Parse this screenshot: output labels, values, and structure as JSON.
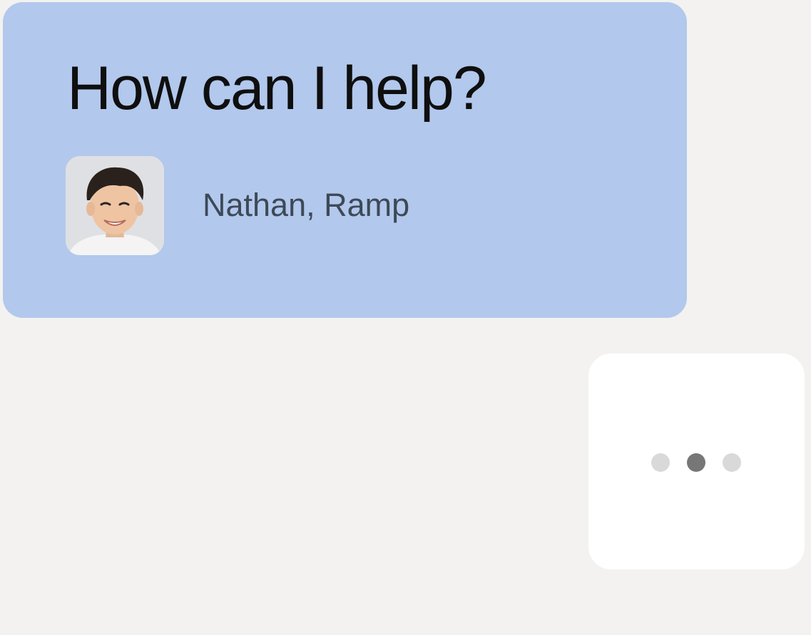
{
  "message": {
    "headline": "How can I help?",
    "agent_name": "Nathan, Ramp"
  },
  "avatar": {
    "icon": "person-photo-icon"
  },
  "typing_indicator": {
    "dot_count": 3,
    "active_dot": 2,
    "colors": {
      "inactive": "#d9d9d9",
      "active": "#777777"
    }
  },
  "colors": {
    "background": "#f3f2f0",
    "card": "#b2c8ec",
    "headline": "#0f0f0f",
    "agent_name": "#3d4957",
    "typing_card": "#ffffff"
  }
}
